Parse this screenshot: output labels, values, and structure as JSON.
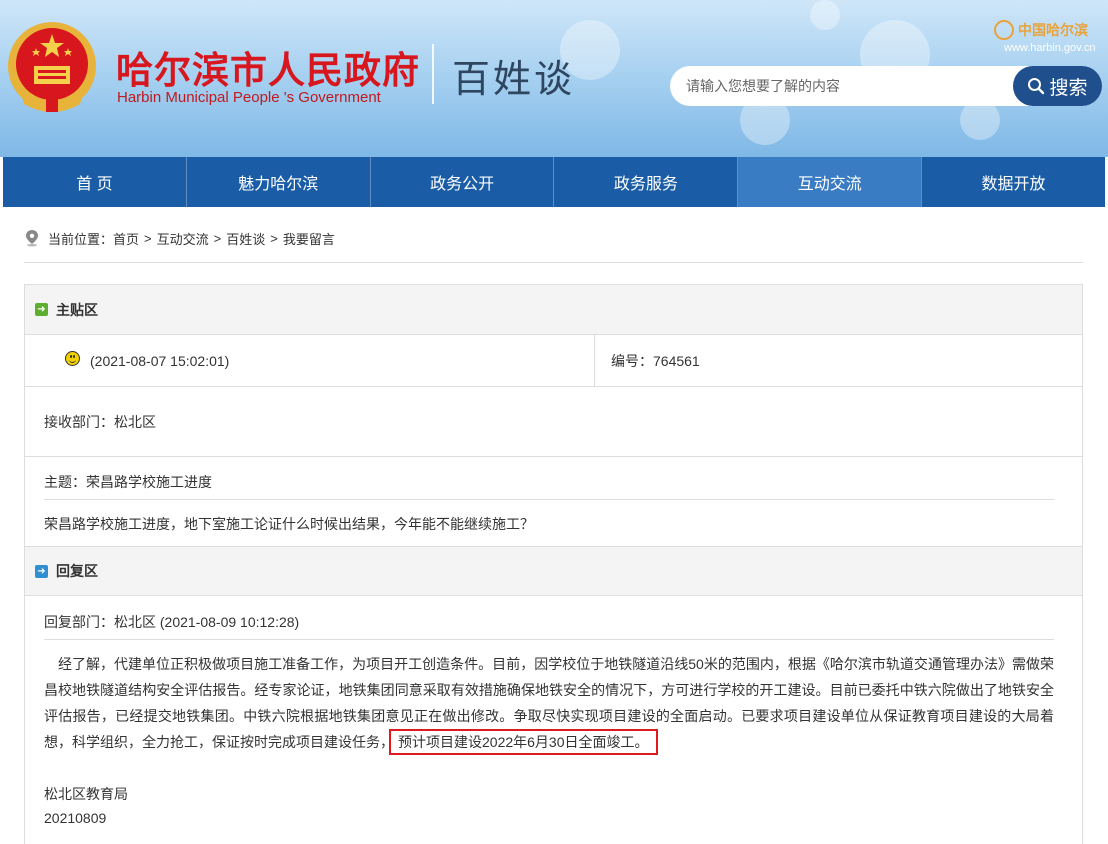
{
  "header": {
    "gov_name_cn": "哈尔滨市人民政府",
    "gov_name_en": "Harbin Municipal People 's Government",
    "section_title": "百姓谈",
    "brand_logo": "中国哈尔滨",
    "brand_url": "www.harbin.gov.cn",
    "search_placeholder": "请输入您想要了解的内容",
    "search_button": "搜索",
    "colors": {
      "brand_red": "#d7161e",
      "nav_blue": "#1a5da6",
      "nav_active": "#3a7cc3",
      "search_button": "#1f4f8d"
    }
  },
  "nav": [
    {
      "label": "首 页",
      "active": false
    },
    {
      "label": "魅力哈尔滨",
      "active": false
    },
    {
      "label": "政务公开",
      "active": false
    },
    {
      "label": "政务服务",
      "active": false
    },
    {
      "label": "互动交流",
      "active": true
    },
    {
      "label": "数据开放",
      "active": false
    }
  ],
  "breadcrumb": {
    "prefix": "当前位置：",
    "items": [
      "首页",
      "互动交流",
      "百姓谈",
      "我要留言"
    ],
    "separator": ">"
  },
  "main_post": {
    "heading": "主贴区",
    "timestamp": "(2021-08-07 15:02:01)",
    "number_label": "编号：",
    "number": "764561",
    "department": "接收部门：松北区",
    "subject": "主题：荣昌路学校施工进度",
    "question": "荣昌路学校施工进度，地下室施工论证什么时候出结果，今年能不能继续施工？"
  },
  "reply": {
    "heading": "回复区",
    "department_line": "回复部门：松北区 (2021-08-09 10:12:28)",
    "body_text": "经了解，代建单位正积极做项目施工准备工作，为项目开工创造条件。目前，因学校位于地铁隧道沿线50米的范围内，根据《哈尔滨市轨道交通管理办法》需做荣昌校地铁隧道结构安全评估报告。经专家论证，地铁集团同意采取有效措施确保地铁安全的情况下，方可进行学校的开工建设。目前已委托中铁六院做出了地铁安全评估报告，已经提交地铁集团。中铁六院根据地铁集团意见正在做出修改。争取尽快实现项目建设的全面启动。已要求项目建设单位从保证教育项目建设的大局着想，科学组织，全力抢工，保证按时完成项目建设任务，",
    "body_highlight": "预计项目建设2022年6月30日全面竣工。",
    "signer": "松北区教育局",
    "date": "20210809"
  }
}
